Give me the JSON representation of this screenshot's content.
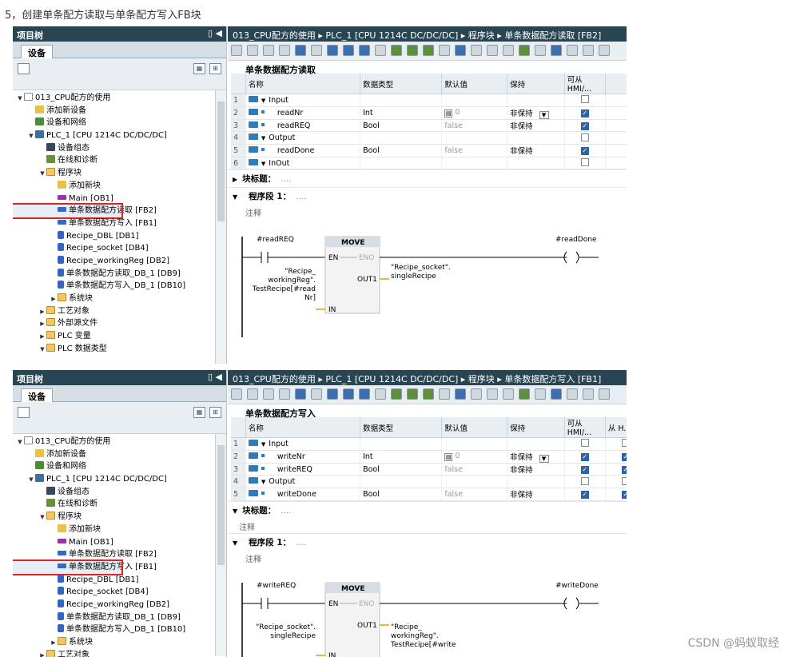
{
  "caption": "5，创建单条配方读取与单条配方写入FB块",
  "watermark": "CSDN @蚂蚁取经",
  "left_panel": {
    "title": "项目树",
    "tab": "设备"
  },
  "tree": [
    {
      "label": "013_CPU配方的使用",
      "icon": "proj",
      "indent": 0,
      "arrow": "▼"
    },
    {
      "label": "添加新设备",
      "icon": "add",
      "indent": 1,
      "arrow": ""
    },
    {
      "label": "设备和网络",
      "icon": "net",
      "indent": 1,
      "arrow": ""
    },
    {
      "label": "PLC_1 [CPU 1214C DC/DC/DC]",
      "icon": "plc",
      "indent": 1,
      "arrow": "▼"
    },
    {
      "label": "设备组态",
      "icon": "cfg",
      "indent": 2,
      "arrow": ""
    },
    {
      "label": "在线和诊断",
      "icon": "diag",
      "indent": 2,
      "arrow": ""
    },
    {
      "label": "程序块",
      "icon": "folder",
      "indent": 2,
      "arrow": "▼"
    },
    {
      "label": "添加新块",
      "icon": "add",
      "indent": 3,
      "arrow": ""
    },
    {
      "label": "Main [OB1]",
      "icon": "ob",
      "indent": 3,
      "arrow": ""
    },
    {
      "label": "单条数据配方读取 [FB2]",
      "icon": "fb",
      "indent": 3,
      "arrow": ""
    },
    {
      "label": "单条数据配方写入 [FB1]",
      "icon": "fb",
      "indent": 3,
      "arrow": ""
    },
    {
      "label": "Recipe_DBL [DB1]",
      "icon": "db",
      "indent": 3,
      "arrow": ""
    },
    {
      "label": "Recipe_socket [DB4]",
      "icon": "db",
      "indent": 3,
      "arrow": ""
    },
    {
      "label": "Recipe_workingReg [DB2]",
      "icon": "db",
      "indent": 3,
      "arrow": ""
    },
    {
      "label": "单条数据配方读取_DB_1 [DB9]",
      "icon": "db",
      "indent": 3,
      "arrow": ""
    },
    {
      "label": "单条数据配方写入_DB_1 [DB10]",
      "icon": "db",
      "indent": 3,
      "arrow": ""
    },
    {
      "label": "系统块",
      "icon": "folder",
      "indent": 3,
      "arrow": "▶"
    },
    {
      "label": "工艺对象",
      "icon": "folder",
      "indent": 2,
      "arrow": "▶"
    },
    {
      "label": "外部源文件",
      "icon": "folder",
      "indent": 2,
      "arrow": "▶"
    },
    {
      "label": "PLC 变量",
      "icon": "folder",
      "indent": 2,
      "arrow": "▶"
    },
    {
      "label": "PLC 数据类型",
      "icon": "folder",
      "indent": 2,
      "arrow": "▼"
    }
  ],
  "table_headers": [
    "名称",
    "数据类型",
    "默认值",
    "保持",
    "可从 HMI/..."
  ],
  "section_block_title": "块标题：",
  "section_block_title_dim": "....",
  "section_network": "程序段 1：",
  "section_network_dim": "....",
  "comment": "注释",
  "move_box": {
    "title": "MOVE",
    "en": "EN",
    "eno": "ENO",
    "in": "IN",
    "out": "OUT1"
  },
  "shots": [
    {
      "breadcrumb": "013_CPU配方的使用 ▸ PLC_1 [CPU 1214C DC/DC/DC] ▸ 程序块 ▸ 单条数据配方读取 [FB2]",
      "block_title": "单条数据配方读取",
      "selected_index": 9,
      "rows": [
        {
          "num": "1",
          "name": "Input",
          "type": "",
          "default": "",
          "retain": "",
          "hmi": false,
          "section": true
        },
        {
          "num": "2",
          "name": "readNr",
          "type": "Int",
          "default": "0",
          "retain": "非保持",
          "hmi": true,
          "section": false
        },
        {
          "num": "3",
          "name": "readREQ",
          "type": "Bool",
          "default": "false",
          "retain": "非保持",
          "hmi": true,
          "section": false
        },
        {
          "num": "4",
          "name": "Output",
          "type": "",
          "default": "",
          "retain": "",
          "hmi": false,
          "section": true
        },
        {
          "num": "5",
          "name": "readDone",
          "type": "Bool",
          "default": "false",
          "retain": "非保持",
          "hmi": true,
          "section": false
        },
        {
          "num": "6",
          "name": "InOut",
          "type": "",
          "default": "",
          "retain": "",
          "hmi": false,
          "section": true
        }
      ],
      "contact": "#readREQ",
      "coil": "#readDone",
      "in_operand": [
        "\"Recipe_",
        "workingReg\".",
        "TestRecipe[#read",
        "Nr]"
      ],
      "out_operand": [
        "\"Recipe_socket\".",
        "singleRecipe"
      ]
    },
    {
      "breadcrumb": "013_CPU配方的使用 ▸ PLC_1 [CPU 1214C DC/DC/DC] ▸ 程序块 ▸ 单条数据配方写入 [FB1]",
      "block_title": "单条数据配方写入",
      "selected_index": 10,
      "extra_header": "从 H...",
      "rows": [
        {
          "num": "1",
          "name": "Input",
          "type": "",
          "default": "",
          "retain": "",
          "hmi": false,
          "section": true
        },
        {
          "num": "2",
          "name": "writeNr",
          "type": "Int",
          "default": "0",
          "retain": "非保持",
          "hmi": true,
          "section": false
        },
        {
          "num": "3",
          "name": "writeREQ",
          "type": "Bool",
          "default": "false",
          "retain": "非保持",
          "hmi": true,
          "section": false
        },
        {
          "num": "4",
          "name": "Output",
          "type": "",
          "default": "",
          "retain": "",
          "hmi": false,
          "section": true
        },
        {
          "num": "5",
          "name": "writeDone",
          "type": "Bool",
          "default": "false",
          "retain": "非保持",
          "hmi": true,
          "section": false
        },
        {
          "num": "6",
          "name": "InOut",
          "type": "",
          "default": "",
          "retain": "",
          "hmi": false,
          "section": true
        }
      ],
      "contact": "#writeREQ",
      "coil": "#writeDone",
      "in_operand": [
        "\"Recipe_socket\".",
        "singleRecipe"
      ],
      "out_operand": [
        "\"Recipe_",
        "workingReg\".",
        "TestRecipe[#write"
      ]
    }
  ]
}
